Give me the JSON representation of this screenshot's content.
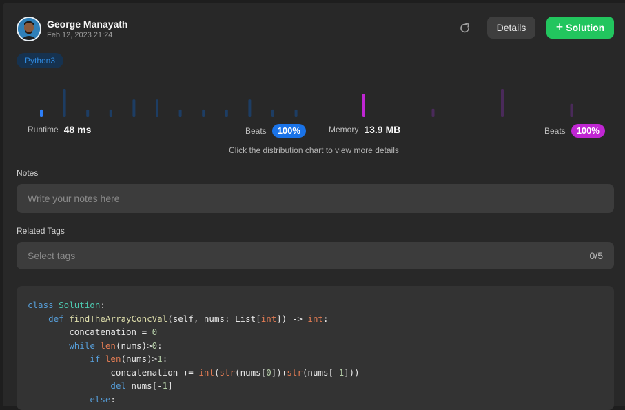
{
  "user": {
    "name": "George Manayath",
    "date": "Feb 12, 2023 21:24"
  },
  "actions": {
    "details_label": "Details",
    "solution_label": "Solution",
    "reload_icon": "reload-icon",
    "plus_icon": "+"
  },
  "language_tag": "Python3",
  "colors": {
    "runtime_active": "#2d7ff9",
    "runtime_inactive": "#1d3d63",
    "memory_active": "#c026d3",
    "memory_inactive": "#4a2a5a",
    "solution_button": "#22c55e"
  },
  "chart_data": [
    {
      "type": "bar",
      "metric": "Runtime",
      "relative_heights": [
        0.27,
        1.0,
        0.27,
        0.27,
        0.63,
        0.63,
        0.27,
        0.27,
        0.27,
        0.63,
        0.27,
        0.27
      ],
      "highlighted_index": 0
    },
    {
      "type": "bar",
      "metric": "Memory",
      "relative_heights": [
        0.83,
        0.3,
        1.0,
        0.47
      ],
      "highlighted_index": 0
    }
  ],
  "stats": {
    "runtime_label": "Runtime",
    "runtime_value": "48 ms",
    "runtime_beats_label": "Beats",
    "runtime_beats_value": "100%",
    "memory_label": "Memory",
    "memory_value": "13.9 MB",
    "memory_beats_label": "Beats",
    "memory_beats_value": "100%"
  },
  "hint": "Click the distribution chart to view more details",
  "notes": {
    "label": "Notes",
    "placeholder": "Write your notes here",
    "value": ""
  },
  "tags": {
    "label": "Related Tags",
    "placeholder": "Select tags",
    "count": "0/5"
  },
  "code": {
    "lines": [
      [
        [
          "kw",
          "class "
        ],
        [
          "cls",
          "Solution"
        ],
        [
          "op",
          ":"
        ]
      ],
      [
        [
          "op",
          "    "
        ],
        [
          "kw",
          "def "
        ],
        [
          "fn",
          "findTheArrayConcVal"
        ],
        [
          "op",
          "(self, nums: List["
        ],
        [
          "bi",
          "int"
        ],
        [
          "op",
          "]) -> "
        ],
        [
          "bi",
          "int"
        ],
        [
          "op",
          ":"
        ]
      ],
      [
        [
          "op",
          "        concatenation = "
        ],
        [
          "num",
          "0"
        ]
      ],
      [
        [
          "op",
          "        "
        ],
        [
          "kw",
          "while "
        ],
        [
          "bi",
          "len"
        ],
        [
          "op",
          "(nums)>"
        ],
        [
          "num",
          "0"
        ],
        [
          "op",
          ":"
        ]
      ],
      [
        [
          "op",
          "            "
        ],
        [
          "kw",
          "if "
        ],
        [
          "bi",
          "len"
        ],
        [
          "op",
          "(nums)>"
        ],
        [
          "num",
          "1"
        ],
        [
          "op",
          ":"
        ]
      ],
      [
        [
          "op",
          "                concatenation += "
        ],
        [
          "bi",
          "int"
        ],
        [
          "op",
          "("
        ],
        [
          "bi",
          "str"
        ],
        [
          "op",
          "(nums["
        ],
        [
          "num",
          "0"
        ],
        [
          "op",
          "])+"
        ],
        [
          "bi",
          "str"
        ],
        [
          "op",
          "(nums[-"
        ],
        [
          "num",
          "1"
        ],
        [
          "op",
          "]))"
        ]
      ],
      [
        [
          "op",
          "                "
        ],
        [
          "kw",
          "del "
        ],
        [
          "op",
          "nums[-"
        ],
        [
          "num",
          "1"
        ],
        [
          "op",
          "]"
        ]
      ],
      [
        [
          "op",
          "            "
        ],
        [
          "kw",
          "else"
        ],
        [
          "op",
          ":"
        ]
      ]
    ]
  }
}
